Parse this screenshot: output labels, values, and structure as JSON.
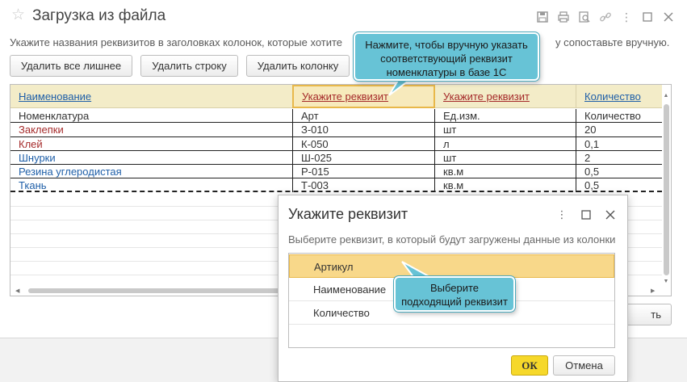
{
  "window": {
    "title": "Загрузка из файла",
    "hint": "Укажите названия реквизитов в заголовках колонок, которые хотите",
    "hint_tail": "у сопоставьте вручную."
  },
  "toolbar": {
    "remove_extra": "Удалить все лишнее",
    "remove_row": "Удалить строку",
    "remove_column": "Удалить колонку"
  },
  "grid": {
    "headers": [
      "Наименование",
      "Укажите реквизит",
      "Укажите реквизит",
      "Количество"
    ],
    "subheader": [
      "Номенклатура",
      "Арт",
      "Ед.изм.",
      "Количество"
    ],
    "rows": [
      [
        "Заклепки",
        "З-010",
        "шт",
        "20"
      ],
      [
        "Клей",
        "К-050",
        "л",
        "0,1"
      ],
      [
        "Шнурки",
        "Ш-025",
        "шт",
        "2"
      ],
      [
        "Резина углеродистая",
        "Р-015",
        "кв.м",
        "0,5"
      ],
      [
        "Ткань",
        "Т-003",
        "кв.м",
        "0,5"
      ]
    ]
  },
  "bottom_button_partial": "ть",
  "callout_top": "Нажмите, чтобы вручную указать соответствующий реквизит номенклатуры в базе 1С",
  "callout_dialog": "Выберите подходящий реквизит",
  "dialog": {
    "title": "Укажите реквизит",
    "hint": "Выберите реквизит, в который будут загружены данные из колонки",
    "items": [
      "Артикул",
      "Наименование",
      "Количество"
    ],
    "ok": "ОК",
    "cancel": "Отмена"
  },
  "colors": {
    "header_bg": "#f3ecc8",
    "link": "#1f5fa8",
    "red_text": "#a52a2a",
    "callout": "#67c3d6",
    "selected": "#f8d88a",
    "ok_button": "#f6d82a"
  }
}
